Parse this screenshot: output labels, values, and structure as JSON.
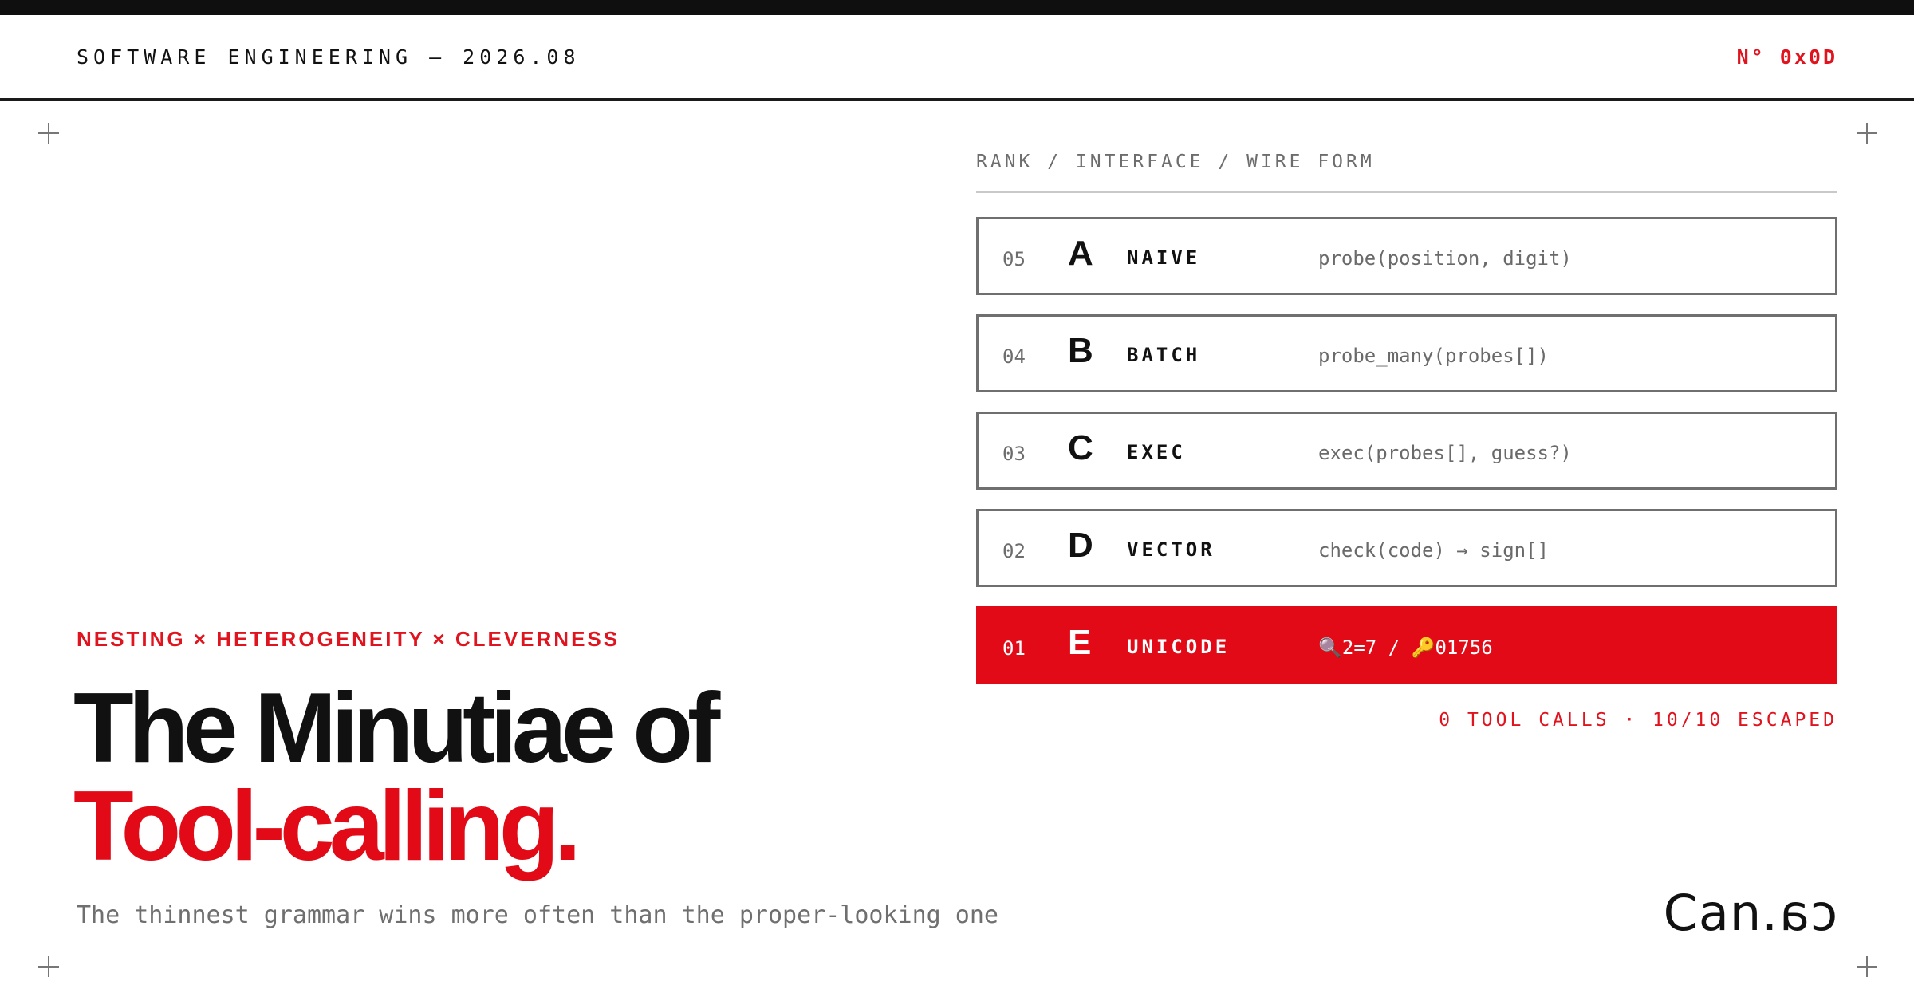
{
  "header": {
    "left": "SOFTWARE ENGINEERING — 2026.08",
    "right": "N° 0x0D"
  },
  "ranking": {
    "column_header": "RANK / INTERFACE / WIRE FORM",
    "rows": [
      {
        "rank": "05",
        "letter": "A",
        "interface": "NAIVE",
        "wire": "probe(position, digit)",
        "active": false
      },
      {
        "rank": "04",
        "letter": "B",
        "interface": "BATCH",
        "wire": "probe_many(probes[])",
        "active": false
      },
      {
        "rank": "03",
        "letter": "C",
        "interface": "EXEC",
        "wire": "exec(probes[], guess?)",
        "active": false
      },
      {
        "rank": "02",
        "letter": "D",
        "interface": "VECTOR",
        "wire": "check(code) → sign[]",
        "active": false
      },
      {
        "rank": "01",
        "letter": "E",
        "interface": "UNICODE",
        "wire": "🔍2=7 / 🔑01756",
        "active": true
      }
    ],
    "summary": "0 TOOL CALLS · 10/10 ESCAPED"
  },
  "hero": {
    "kicker": "NESTING × HETEROGENEITY × CLEVERNESS",
    "title_line1": "The Minutiae of",
    "title_line2": "Tool-calling.",
    "subtitle": "The thinnest grammar wins more often than the proper-looking one"
  },
  "logo": {
    "text_left": "Can.",
    "text_right_mirrored": "ca"
  },
  "colors": {
    "accent": "#e20a16",
    "ink": "#111111",
    "muted": "#6f6f6f",
    "rule": "#c9c9c9"
  }
}
